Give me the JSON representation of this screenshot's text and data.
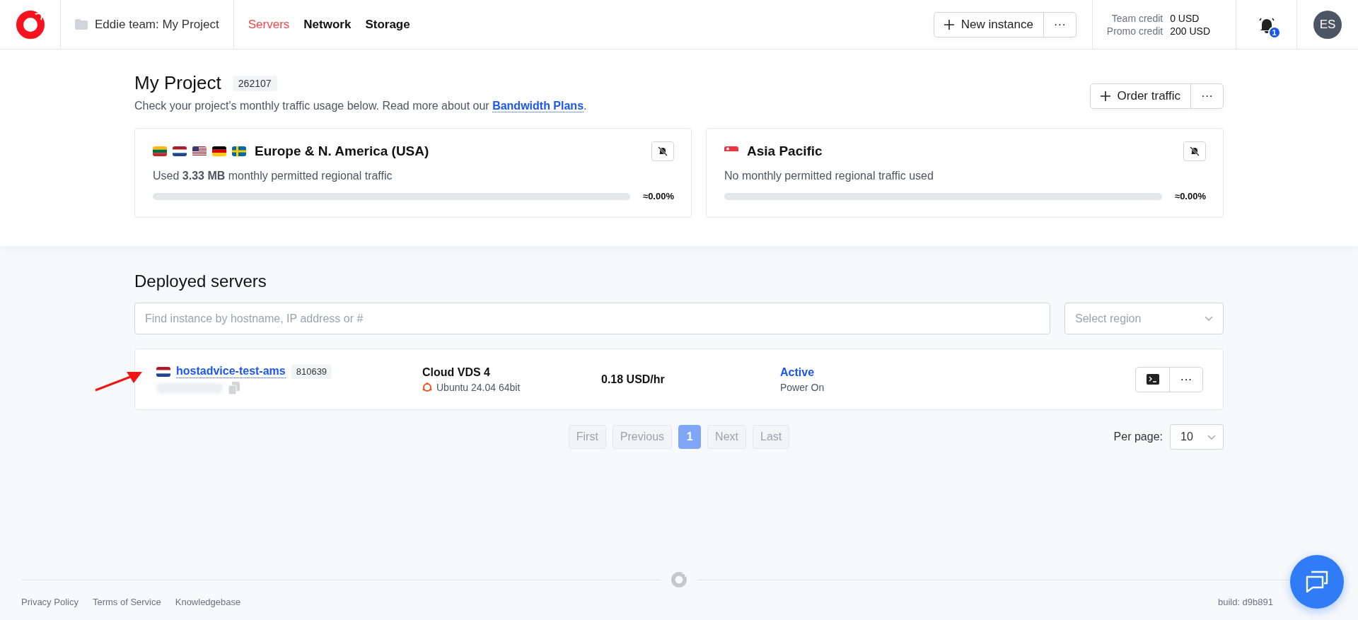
{
  "header": {
    "project": "Eddie team: My Project",
    "nav": [
      {
        "label": "Servers",
        "selected": true
      },
      {
        "label": "Network",
        "selected": false
      },
      {
        "label": "Storage",
        "selected": false
      }
    ],
    "new_instance": "New instance",
    "more": "···",
    "credits": [
      {
        "label": "Team credit",
        "value": "0 USD"
      },
      {
        "label": "Promo credit",
        "value": "200 USD"
      }
    ],
    "notifications": "1",
    "avatar": "ES"
  },
  "project": {
    "title": "My Project",
    "id": "262107",
    "description": "Check your project's monthly traffic usage below. Read more about our",
    "link": "Bandwidth Plans",
    "link_end": ".",
    "order_traffic": "Order traffic",
    "more": "···",
    "regions": [
      {
        "name": "Europe & N. America (USA)",
        "usage": "Used **3.33 MB** monthly permitted regional traffic",
        "level": 0,
        "percent": "≈0.00%"
      },
      {
        "name": "Asia Pacific",
        "usage": "No monthly permitted regional traffic used",
        "level": 0,
        "percent": "≈0.00%"
      }
    ]
  },
  "servers": {
    "title": "Deployed servers",
    "search": {
      "placeholder": "Find instance by hostname, IP address or #"
    },
    "region_select": {
      "placeholder": "Select region"
    },
    "rows": [
      {
        "hostname": "hostadvice-test-ams",
        "id": "810639",
        "plan": "Cloud VDS 4",
        "os": "Ubuntu 24.04 64bit",
        "price": "0.18 USD/hr",
        "status": "Active",
        "power": "Power On",
        "more": "···"
      }
    ],
    "pagination": [
      {
        "label": "First",
        "disabled": true,
        "selected": false
      },
      {
        "label": "Previous",
        "disabled": true,
        "selected": false
      },
      {
        "label": "1",
        "disabled": false,
        "selected": true
      },
      {
        "label": "Next",
        "disabled": true,
        "selected": false
      },
      {
        "label": "Last",
        "disabled": true,
        "selected": false
      }
    ],
    "per_page": {
      "label": "Per page:",
      "value": "10"
    }
  },
  "footer": {
    "links": [
      "Privacy Policy",
      "Terms of Service",
      "Knowledgebase"
    ],
    "build": "build: d9b891"
  }
}
